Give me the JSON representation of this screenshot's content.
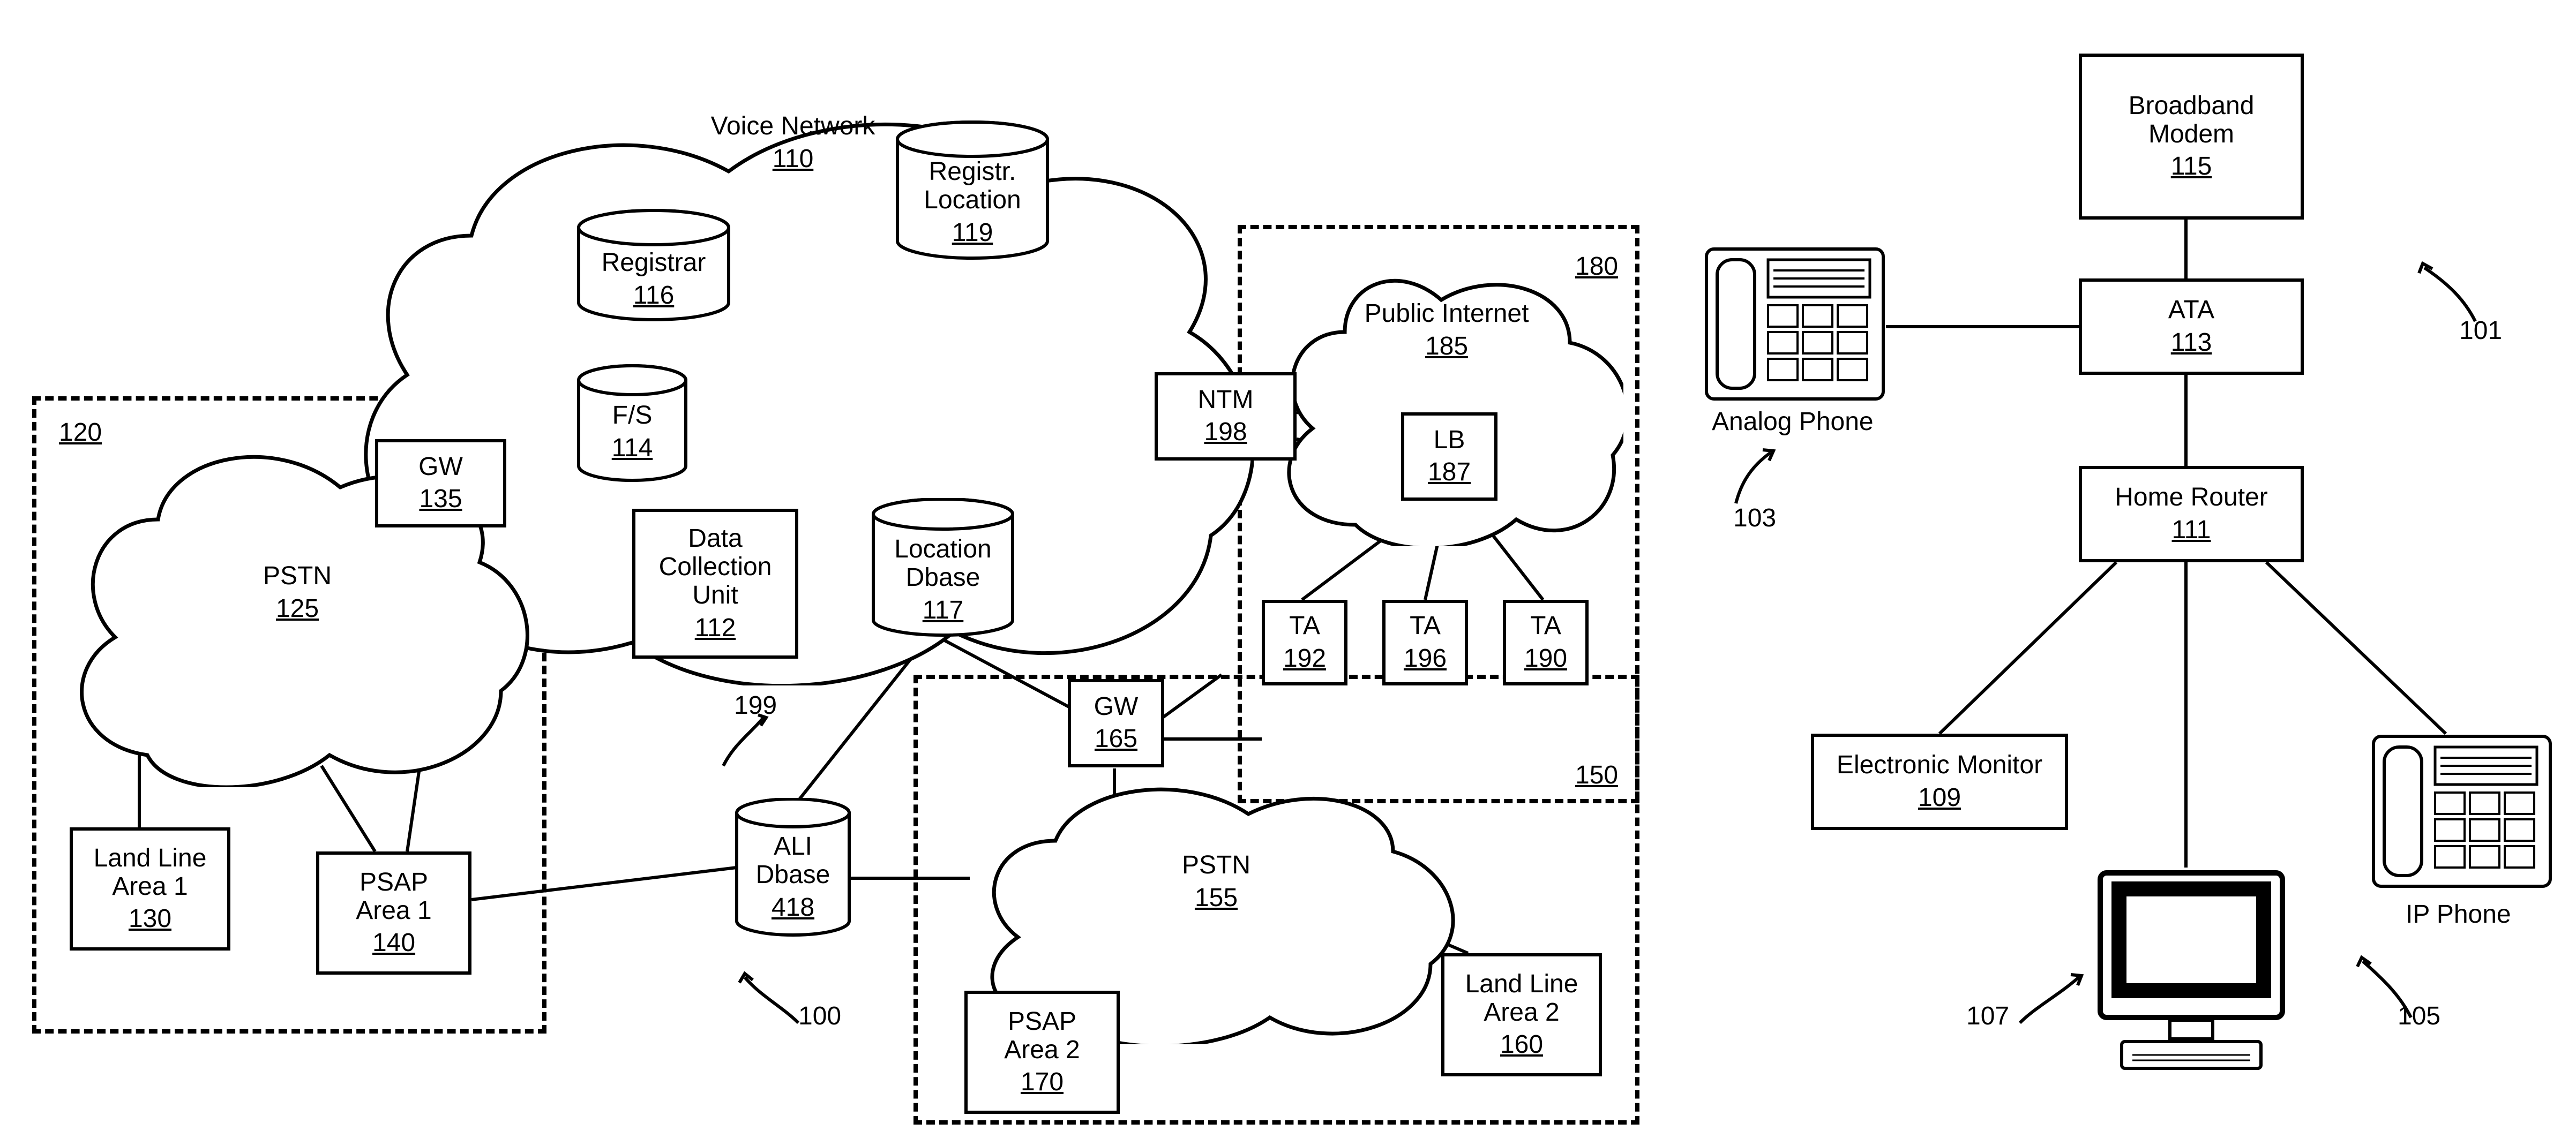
{
  "clouds": {
    "voice_network": {
      "label": "Voice Network",
      "ref": "110"
    },
    "pstn1": {
      "label": "PSTN",
      "ref": "125"
    },
    "public_internet": {
      "label": "Public Internet",
      "ref": "185"
    },
    "pstn2": {
      "label": "PSTN",
      "ref": "155"
    }
  },
  "cylinders": {
    "registrar": {
      "label": "Registrar",
      "ref": "116"
    },
    "registr_location": {
      "label": "Registr.\nLocation",
      "ref": "119"
    },
    "fs": {
      "label": "F/S",
      "ref": "114"
    },
    "location_dbase": {
      "label": "Location\nDbase",
      "ref": "117"
    },
    "ali_dbase": {
      "label": "ALI\nDbase",
      "ref": "418"
    }
  },
  "boxes": {
    "gw1": {
      "label": "GW",
      "ref": "135"
    },
    "data_collection": {
      "label": "Data\nCollection\nUnit",
      "ref": "112"
    },
    "ntm": {
      "label": "NTM",
      "ref": "198"
    },
    "lb": {
      "label": "LB",
      "ref": "187"
    },
    "ta1": {
      "label": "TA",
      "ref": "192"
    },
    "ta2": {
      "label": "TA",
      "ref": "196"
    },
    "ta3": {
      "label": "TA",
      "ref": "190"
    },
    "gw2": {
      "label": "GW",
      "ref": "165"
    },
    "land_line_1": {
      "label": "Land Line\nArea 1",
      "ref": "130"
    },
    "psap_1": {
      "label": "PSAP\nArea 1",
      "ref": "140"
    },
    "psap_2": {
      "label": "PSAP\nArea 2",
      "ref": "170"
    },
    "land_line_2": {
      "label": "Land Line\nArea 2",
      "ref": "160"
    },
    "broadband_modem": {
      "label": "Broadband\nModem",
      "ref": "115"
    },
    "ata": {
      "label": "ATA",
      "ref": "113"
    },
    "home_router": {
      "label": "Home Router",
      "ref": "111"
    },
    "electronic_monitor": {
      "label": "Electronic Monitor",
      "ref": "109"
    }
  },
  "float_refs": {
    "r120": "120",
    "r180": "180",
    "r150": "150",
    "r199": "199",
    "r100": "100",
    "r103": "103",
    "r101": "101",
    "r107": "107",
    "r105": "105"
  },
  "plain_labels": {
    "analog_phone": "Analog Phone",
    "ip_phone": "IP Phone"
  }
}
